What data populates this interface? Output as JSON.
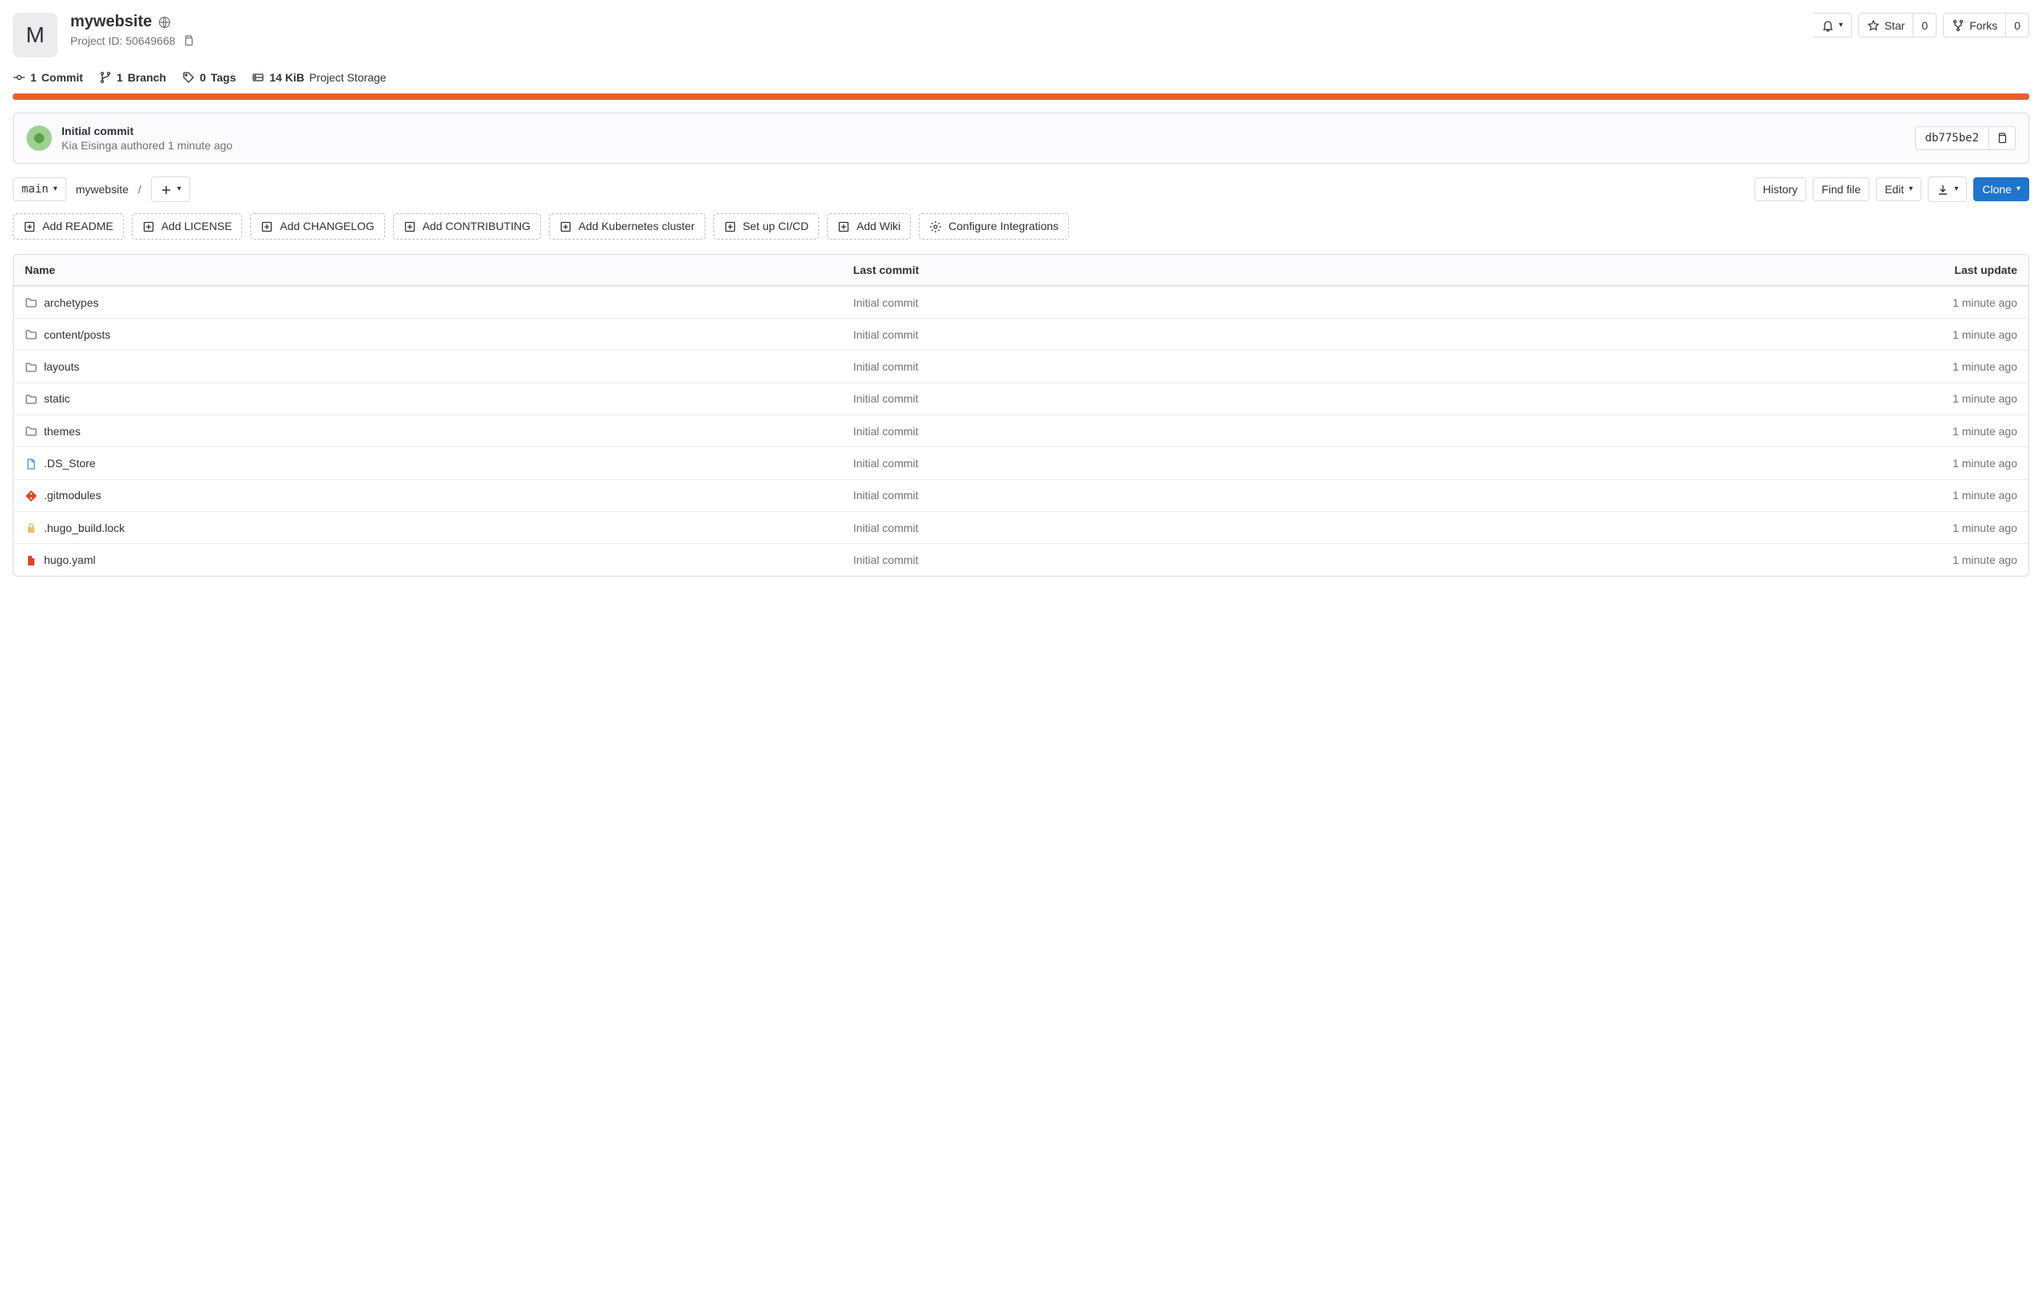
{
  "project": {
    "avatar_letter": "M",
    "name": "mywebsite",
    "id_label": "Project ID: 50649668"
  },
  "actions": {
    "star_label": "Star",
    "star_count": "0",
    "forks_label": "Forks",
    "forks_count": "0"
  },
  "stats": {
    "commits_count": "1",
    "commits_label": "Commit",
    "branches_count": "1",
    "branches_label": "Branch",
    "tags_count": "0",
    "tags_label": "Tags",
    "storage_size": "14 KiB",
    "storage_label": "Project Storage"
  },
  "last_commit": {
    "title": "Initial commit",
    "author": "Kia Eisinga",
    "verb": " authored ",
    "time": "1 minute ago",
    "sha": "db775be2"
  },
  "toolbar": {
    "branch": "main",
    "breadcrumb": "mywebsite",
    "history": "History",
    "find_file": "Find file",
    "edit": "Edit",
    "clone": "Clone"
  },
  "suggestions": [
    "Add README",
    "Add LICENSE",
    "Add CHANGELOG",
    "Add CONTRIBUTING",
    "Add Kubernetes cluster",
    "Set up CI/CD",
    "Add Wiki",
    "Configure Integrations"
  ],
  "table": {
    "headers": {
      "name": "Name",
      "last_commit": "Last commit",
      "last_update": "Last update"
    },
    "rows": [
      {
        "icon": "folder",
        "name": "archetypes",
        "commit": "Initial commit",
        "update": "1 minute ago"
      },
      {
        "icon": "folder",
        "name": "content/posts",
        "commit": "Initial commit",
        "update": "1 minute ago"
      },
      {
        "icon": "folder",
        "name": "layouts",
        "commit": "Initial commit",
        "update": "1 minute ago"
      },
      {
        "icon": "folder",
        "name": "static",
        "commit": "Initial commit",
        "update": "1 minute ago"
      },
      {
        "icon": "folder",
        "name": "themes",
        "commit": "Initial commit",
        "update": "1 minute ago"
      },
      {
        "icon": "file-blue",
        "name": ".DS_Store",
        "commit": "Initial commit",
        "update": "1 minute ago"
      },
      {
        "icon": "git",
        "name": ".gitmodules",
        "commit": "Initial commit",
        "update": "1 minute ago"
      },
      {
        "icon": "lock",
        "name": ".hugo_build.lock",
        "commit": "Initial commit",
        "update": "1 minute ago"
      },
      {
        "icon": "yaml",
        "name": "hugo.yaml",
        "commit": "Initial commit",
        "update": "1 minute ago"
      }
    ]
  }
}
